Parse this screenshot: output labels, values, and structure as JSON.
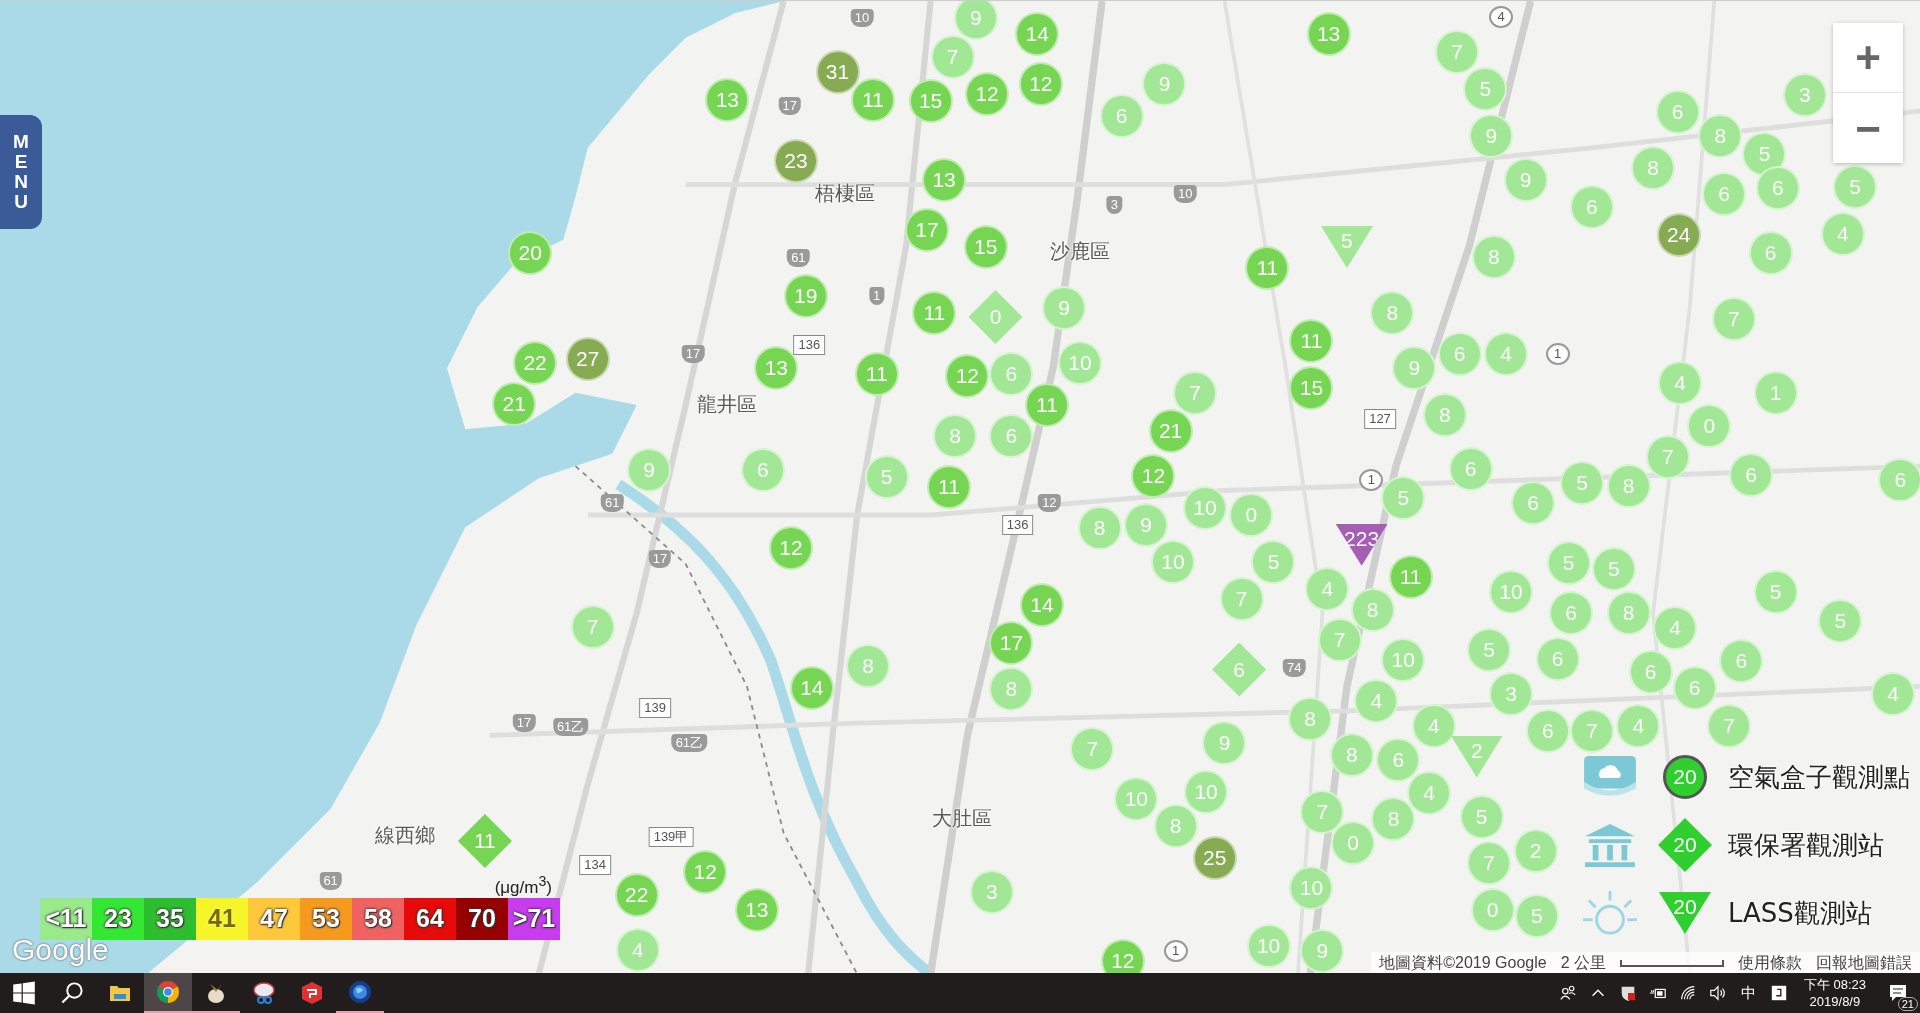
{
  "menu_button": {
    "label": "MENU"
  },
  "zoom_controls": [
    {
      "kind": "zoom-in",
      "label": "+"
    },
    {
      "kind": "zoom-out",
      "label": "−"
    }
  ],
  "place_labels": [
    {
      "text": "梧棲區"
    },
    {
      "text": "沙鹿區"
    },
    {
      "text": "龍井區"
    },
    {
      "text": "大肚區"
    },
    {
      "text": "線西鄉"
    }
  ],
  "road_shields": [
    {
      "text": "10",
      "kind": "route"
    },
    {
      "text": "17",
      "kind": "route"
    },
    {
      "text": "61",
      "kind": "route"
    },
    {
      "text": "1",
      "kind": "route"
    },
    {
      "text": "136",
      "kind": "county"
    },
    {
      "text": "17",
      "kind": "route"
    },
    {
      "text": "3",
      "kind": "route"
    },
    {
      "text": "10",
      "kind": "route"
    },
    {
      "text": "61",
      "kind": "route"
    },
    {
      "text": "17",
      "kind": "route"
    },
    {
      "text": "12",
      "kind": "route"
    },
    {
      "text": "136",
      "kind": "county"
    },
    {
      "text": "127",
      "kind": "county"
    },
    {
      "text": "139",
      "kind": "county"
    },
    {
      "text": "17",
      "kind": "route"
    },
    {
      "text": "61乙",
      "kind": "route"
    },
    {
      "text": "61乙",
      "kind": "route"
    },
    {
      "text": "139甲",
      "kind": "county"
    },
    {
      "text": "134",
      "kind": "county"
    },
    {
      "text": "61",
      "kind": "route"
    },
    {
      "text": "74",
      "kind": "route"
    },
    {
      "text": "1",
      "kind": "national"
    },
    {
      "text": "1",
      "kind": "national"
    },
    {
      "text": "4",
      "kind": "national"
    },
    {
      "text": "1",
      "kind": "national"
    }
  ],
  "markers": [
    {
      "kind": "box",
      "value": "7"
    },
    {
      "kind": "box",
      "value": "9"
    },
    {
      "kind": "box",
      "value": "14"
    },
    {
      "kind": "box",
      "value": "13"
    },
    {
      "kind": "box",
      "value": "7"
    },
    {
      "kind": "box",
      "value": "13"
    },
    {
      "kind": "box",
      "value": "31"
    },
    {
      "kind": "box",
      "value": "11"
    },
    {
      "kind": "box",
      "value": "15"
    },
    {
      "kind": "box",
      "value": "12"
    },
    {
      "kind": "box",
      "value": "12"
    },
    {
      "kind": "box",
      "value": "6"
    },
    {
      "kind": "box",
      "value": "9"
    },
    {
      "kind": "box",
      "value": "5"
    },
    {
      "kind": "box",
      "value": "6"
    },
    {
      "kind": "box",
      "value": "3"
    },
    {
      "kind": "box",
      "value": "23"
    },
    {
      "kind": "box",
      "value": "13"
    },
    {
      "kind": "box",
      "value": "9"
    },
    {
      "kind": "box",
      "value": "9"
    },
    {
      "kind": "box",
      "value": "8"
    },
    {
      "kind": "box",
      "value": "8"
    },
    {
      "kind": "box",
      "value": "5"
    },
    {
      "kind": "box",
      "value": "17"
    },
    {
      "kind": "box",
      "value": "6"
    },
    {
      "kind": "box",
      "value": "24"
    },
    {
      "kind": "box",
      "value": "6"
    },
    {
      "kind": "box",
      "value": "6"
    },
    {
      "kind": "box",
      "value": "4"
    },
    {
      "kind": "box",
      "value": "5"
    },
    {
      "kind": "box",
      "value": "20"
    },
    {
      "kind": "box",
      "value": "19"
    },
    {
      "kind": "box",
      "value": "15"
    },
    {
      "kind": "box",
      "value": "11"
    },
    {
      "kind": "lass",
      "value": "5"
    },
    {
      "kind": "box",
      "value": "8"
    },
    {
      "kind": "box",
      "value": "6"
    },
    {
      "kind": "box",
      "value": "22"
    },
    {
      "kind": "box",
      "value": "27"
    },
    {
      "kind": "box",
      "value": "11"
    },
    {
      "kind": "epa",
      "value": "0"
    },
    {
      "kind": "box",
      "value": "9"
    },
    {
      "kind": "box",
      "value": "11"
    },
    {
      "kind": "box",
      "value": "8"
    },
    {
      "kind": "box",
      "value": "6"
    },
    {
      "kind": "box",
      "value": "4"
    },
    {
      "kind": "box",
      "value": "7"
    },
    {
      "kind": "box",
      "value": "21"
    },
    {
      "kind": "box",
      "value": "13"
    },
    {
      "kind": "box",
      "value": "11"
    },
    {
      "kind": "box",
      "value": "12"
    },
    {
      "kind": "box",
      "value": "6"
    },
    {
      "kind": "box",
      "value": "11"
    },
    {
      "kind": "box",
      "value": "10"
    },
    {
      "kind": "box",
      "value": "7"
    },
    {
      "kind": "box",
      "value": "15"
    },
    {
      "kind": "box",
      "value": "9"
    },
    {
      "kind": "box",
      "value": "8"
    },
    {
      "kind": "box",
      "value": "4"
    },
    {
      "kind": "box",
      "value": "0"
    },
    {
      "kind": "box",
      "value": "1"
    },
    {
      "kind": "box",
      "value": "9"
    },
    {
      "kind": "box",
      "value": "6"
    },
    {
      "kind": "box",
      "value": "5"
    },
    {
      "kind": "box",
      "value": "8"
    },
    {
      "kind": "box",
      "value": "11"
    },
    {
      "kind": "box",
      "value": "6"
    },
    {
      "kind": "box",
      "value": "12"
    },
    {
      "kind": "box",
      "value": "21"
    },
    {
      "kind": "box",
      "value": "6"
    },
    {
      "kind": "box",
      "value": "5"
    },
    {
      "kind": "box",
      "value": "8"
    },
    {
      "kind": "box",
      "value": "7"
    },
    {
      "kind": "box",
      "value": "6"
    },
    {
      "kind": "box",
      "value": "6"
    },
    {
      "kind": "box",
      "value": "12"
    },
    {
      "kind": "box",
      "value": "8"
    },
    {
      "kind": "box",
      "value": "9"
    },
    {
      "kind": "box",
      "value": "10"
    },
    {
      "kind": "box",
      "value": "0"
    },
    {
      "kind": "lass",
      "value": "223"
    },
    {
      "kind": "box",
      "value": "5"
    },
    {
      "kind": "box",
      "value": "6"
    },
    {
      "kind": "box",
      "value": "14"
    },
    {
      "kind": "box",
      "value": "10"
    },
    {
      "kind": "box",
      "value": "7"
    },
    {
      "kind": "box",
      "value": "5"
    },
    {
      "kind": "box",
      "value": "4"
    },
    {
      "kind": "box",
      "value": "8"
    },
    {
      "kind": "box",
      "value": "11"
    },
    {
      "kind": "box",
      "value": "10"
    },
    {
      "kind": "box",
      "value": "5"
    },
    {
      "kind": "box",
      "value": "5"
    },
    {
      "kind": "box",
      "value": "8"
    },
    {
      "kind": "box",
      "value": "5"
    },
    {
      "kind": "box",
      "value": "7"
    },
    {
      "kind": "box",
      "value": "8"
    },
    {
      "kind": "box",
      "value": "17"
    },
    {
      "kind": "epa",
      "value": "6"
    },
    {
      "kind": "box",
      "value": "7"
    },
    {
      "kind": "box",
      "value": "10"
    },
    {
      "kind": "box",
      "value": "5"
    },
    {
      "kind": "box",
      "value": "6"
    },
    {
      "kind": "box",
      "value": "6"
    },
    {
      "kind": "box",
      "value": "4"
    },
    {
      "kind": "box",
      "value": "6"
    },
    {
      "kind": "box",
      "value": "5"
    },
    {
      "kind": "box",
      "value": "14"
    },
    {
      "kind": "box",
      "value": "8"
    },
    {
      "kind": "box",
      "value": "8"
    },
    {
      "kind": "box",
      "value": "4"
    },
    {
      "kind": "box",
      "value": "4"
    },
    {
      "kind": "box",
      "value": "3"
    },
    {
      "kind": "box",
      "value": "6"
    },
    {
      "kind": "box",
      "value": "4"
    },
    {
      "kind": "box",
      "value": "6"
    },
    {
      "kind": "box",
      "value": "6"
    },
    {
      "kind": "box",
      "value": "7"
    },
    {
      "kind": "box",
      "value": "4"
    },
    {
      "kind": "box",
      "value": "7"
    },
    {
      "kind": "box",
      "value": "10"
    },
    {
      "kind": "box",
      "value": "9"
    },
    {
      "kind": "box",
      "value": "8"
    },
    {
      "kind": "box",
      "value": "6"
    },
    {
      "kind": "box",
      "value": "4"
    },
    {
      "kind": "lass",
      "value": "2"
    },
    {
      "kind": "box",
      "value": "7"
    },
    {
      "kind": "epa",
      "value": "11"
    },
    {
      "kind": "box",
      "value": "10"
    },
    {
      "kind": "box",
      "value": "8"
    },
    {
      "kind": "box",
      "value": "25"
    },
    {
      "kind": "box",
      "value": "7"
    },
    {
      "kind": "box",
      "value": "0"
    },
    {
      "kind": "box",
      "value": "8"
    },
    {
      "kind": "box",
      "value": "5"
    },
    {
      "kind": "box",
      "value": "2"
    },
    {
      "kind": "box",
      "value": "22"
    },
    {
      "kind": "box",
      "value": "12"
    },
    {
      "kind": "box",
      "value": "13"
    },
    {
      "kind": "box",
      "value": "3"
    },
    {
      "kind": "box",
      "value": "10"
    },
    {
      "kind": "box",
      "value": "7"
    },
    {
      "kind": "box",
      "value": "0"
    },
    {
      "kind": "box",
      "value": "5"
    },
    {
      "kind": "box",
      "value": "4"
    },
    {
      "kind": "box",
      "value": "12"
    },
    {
      "kind": "box",
      "value": "10"
    },
    {
      "kind": "box",
      "value": "9"
    }
  ],
  "station_legend": [
    {
      "kind": "box",
      "value": "20",
      "label": "空氣盒子觀測點"
    },
    {
      "kind": "epa",
      "value": "20",
      "label": "環保署觀測站"
    },
    {
      "kind": "lass",
      "value": "20",
      "label": "LASS觀測站"
    }
  ],
  "pm_legend": {
    "unit": "(μg/m$^{3}$)",
    "items": [
      {
        "label": "<11",
        "color": "#98ea8a"
      },
      {
        "label": "23",
        "color": "#33e833"
      },
      {
        "label": "35",
        "color": "#2ebd2e"
      },
      {
        "label": "41",
        "color": "#f5f52a"
      },
      {
        "label": "47",
        "color": "#ffc83a"
      },
      {
        "label": "53",
        "color": "#f59a1e"
      },
      {
        "label": "58",
        "color": "#f06262"
      },
      {
        "label": "64",
        "color": "#e60a0a"
      },
      {
        "label": "70",
        "color": "#960000"
      },
      {
        "label": ">71",
        "color": "#c83cf0"
      }
    ]
  },
  "attribution": {
    "logo": "Google",
    "map_data": "地圖資料©2019 Google",
    "scale": "2 公里",
    "terms": "使用條款",
    "report": "回報地圖錯誤"
  },
  "taskbar": {
    "apps": [
      {
        "kind": "explorer",
        "selected": false,
        "running": false
      },
      {
        "kind": "chrome",
        "selected": true,
        "running": true
      },
      {
        "kind": "bird",
        "selected": false,
        "running": true
      },
      {
        "kind": "snipping",
        "selected": false,
        "running": false
      },
      {
        "kind": "sketch",
        "selected": false,
        "running": false
      },
      {
        "kind": "globe",
        "selected": false,
        "running": true
      }
    ],
    "tray": {
      "ime": "中",
      "time": "下午 08:23",
      "date": "2019/8/9",
      "notifications": "21"
    }
  }
}
